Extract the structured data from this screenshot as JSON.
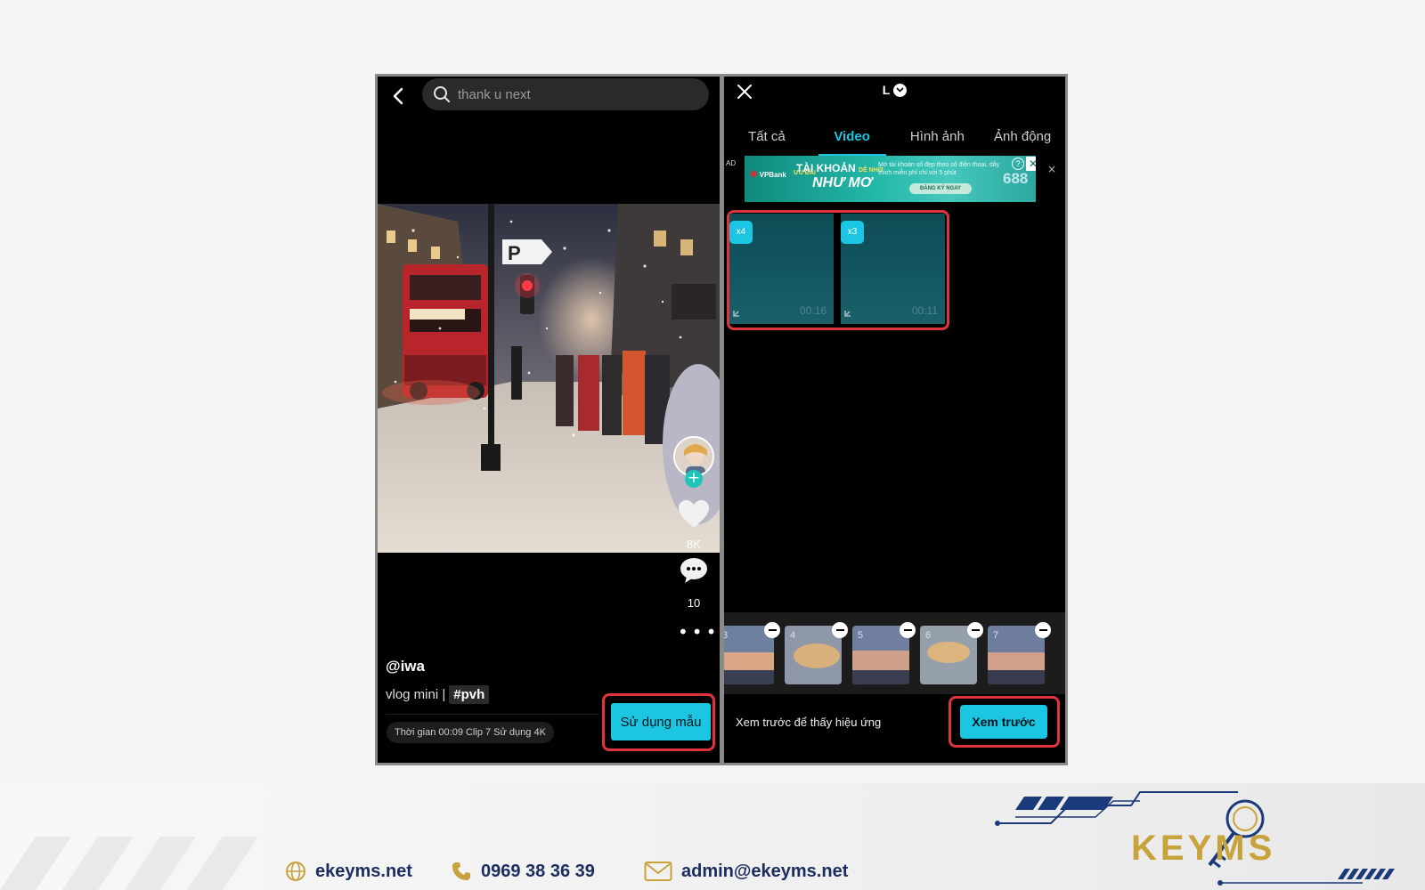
{
  "left_screen": {
    "search": {
      "placeholder": "thank u next"
    },
    "like_count": "8K",
    "comment_count": "10",
    "username": "@iwa",
    "caption": "vlog mini |",
    "hashtag": "#pvh",
    "info": "Thời gian 00:09 Clip 7 Sử dụng 4K",
    "use_template_label": "Sử dụng mẫu"
  },
  "right_screen": {
    "title": "L",
    "tabs": [
      {
        "label": "Tất cả",
        "active": false
      },
      {
        "label": "Video",
        "active": true
      },
      {
        "label": "Hình ảnh",
        "active": false
      },
      {
        "label": "Ảnh động",
        "active": false
      }
    ],
    "ad": {
      "label": "AD",
      "close": "×",
      "brand": "VPBank",
      "tag": "ƯU ĐÃI",
      "headline1": "TÀI KHOẢN",
      "headline1_small": "DỄ NHỚ",
      "headline2": "NHƯ MƠ",
      "desc": "Mở tài khoản số đẹp theo số điện thoại, dãy thích miễn phí chỉ với 5 phút",
      "cta": "ĐĂNG KÝ NGAY",
      "number": "688",
      "help": "?",
      "x": "✕"
    },
    "clips": [
      {
        "badge": "x4",
        "duration": "00:16"
      },
      {
        "badge": "x3",
        "duration": "00:11"
      }
    ],
    "timeline_thumbs": [
      "3",
      "4",
      "5",
      "6",
      "7"
    ],
    "hint": "Xem trước để thấy hiệu ứng",
    "preview_label": "Xem trước"
  },
  "footer": {
    "website": "ekeyms.net",
    "phone": "0969 38 36 39",
    "email": "admin@ekeyms.net",
    "logo_text": "KEYMS"
  },
  "colors": {
    "accent": "#1cc6e2",
    "highlight": "#e0343d",
    "footer_text": "#1b2c5e",
    "logo_gold": "#c8a23a"
  }
}
